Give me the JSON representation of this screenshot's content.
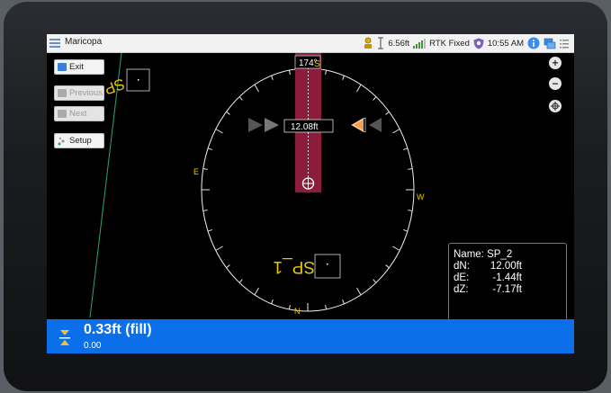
{
  "app": {
    "title": "Maricopa"
  },
  "status": {
    "antenna_height": "6.56ft",
    "gnss_status": "RTK Fixed",
    "time": "10:55 AM"
  },
  "sidebar": {
    "exit_label": "Exit",
    "previous_label": "Previous",
    "next_label": "Next",
    "setup_label": "Setup"
  },
  "compass": {
    "heading": "174°",
    "north_glyph": "S",
    "east_label": "E",
    "west_label": "W",
    "north_label": "N",
    "distance": "12.08ft",
    "point_label": "SP_1",
    "map_point_label": "SP"
  },
  "info": {
    "name_key": "Name:",
    "name_value": "SP_2",
    "dn_key": "dN:",
    "dn_value": "12.00ft",
    "de_key": "dE:",
    "de_value": "-1.44ft",
    "dz_key": "dZ:",
    "dz_value": "-7.17ft"
  },
  "cutfill": {
    "value": "0.33ft (fill)",
    "secondary": "0.00"
  },
  "colors": {
    "accent_blue": "#0a6fe8",
    "track_red": "#8c1c3c",
    "compass_yellow": "#e8c800",
    "target_orange": "#f0a050"
  }
}
